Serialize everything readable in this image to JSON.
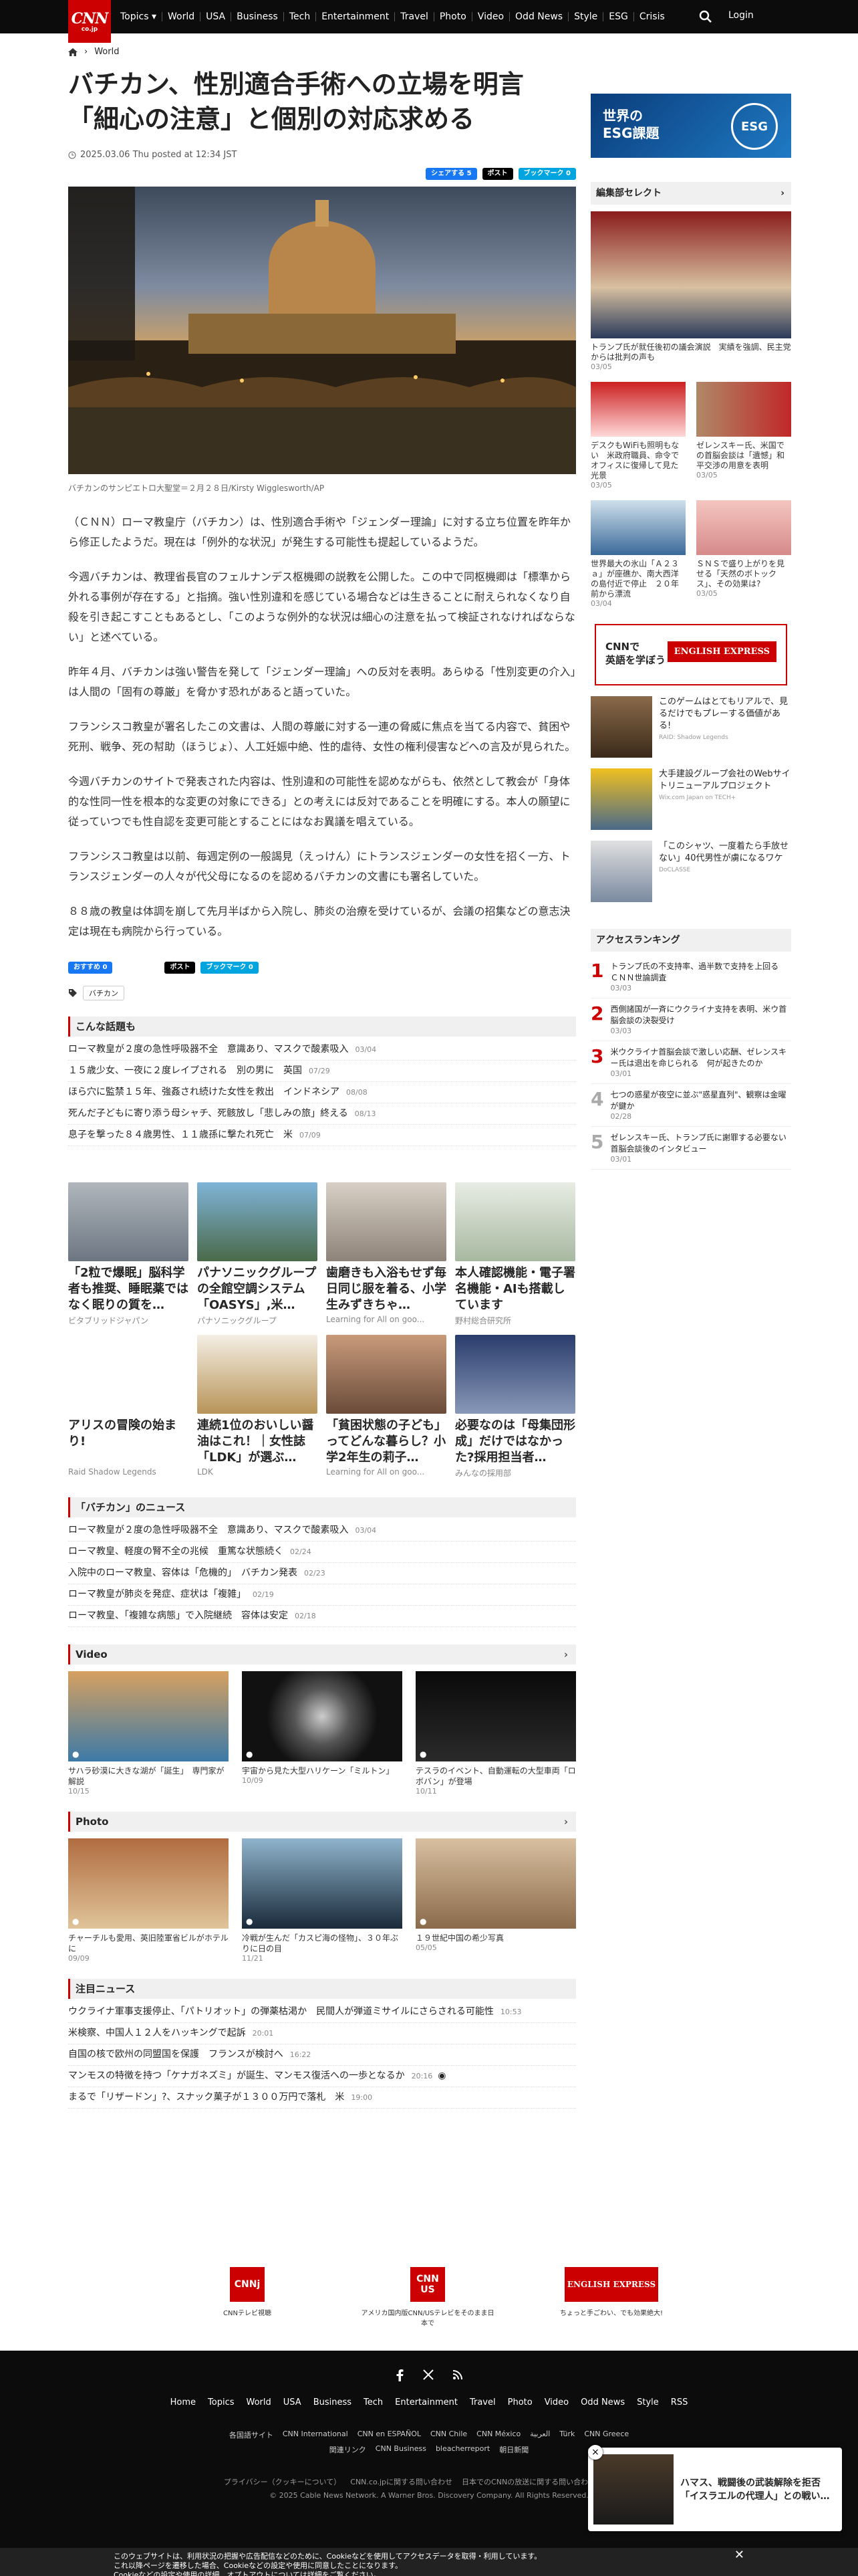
{
  "nav": {
    "items": [
      "Topics",
      "World",
      "USA",
      "Business",
      "Tech",
      "Entertainment",
      "Travel",
      "Photo",
      "Video",
      "Odd News",
      "Style",
      "ESG",
      "Crisis"
    ],
    "login": "Login",
    "logo_top": "CNN",
    "logo_bottom": "co.jp"
  },
  "breadcrumb": {
    "section": "World"
  },
  "article": {
    "title": "バチカン、性別適合手術への立場を明言　「細心の注意」と個別の対応求める",
    "date": "2025.03.06 Thu posted at 12:34 JST",
    "share": {
      "fb": "シェアする 5",
      "x": "ポスト",
      "hatena": "ブックマーク 0"
    },
    "caption": "バチカンのサンピエトロ大聖堂＝２月２８日/Kirsty Wigglesworth/AP",
    "paragraphs": [
      "（ＣＮＮ）ローマ教皇庁（バチカン）は、性別適合手術や「ジェンダー理論」に対する立ち位置を昨年から修正したようだ。現在は「例外的な状況」が発生する可能性も提起しているようだ。",
      "今週バチカンは、教理省長官のフェルナンデス枢機卿の説教を公開した。この中で同枢機卿は「標準から外れる事例が存在する」と指摘。強い性別違和を感じている場合などは生きることに耐えられなくなり自殺を引き起こすこともあるとし、「このような例外的な状況は細心の注意を払って検証されなければならない」と述べている。",
      "昨年４月、バチカンは強い警告を発して「ジェンダー理論」への反対を表明。あらゆる「性別変更の介入」は人間の「固有の尊厳」を脅かす恐れがあると語っていた。",
      "フランシスコ教皇が署名したこの文書は、人間の尊厳に対する一連の脅威に焦点を当てる内容で、貧困や死刑、戦争、死の幇助（ほうじょ）、人工妊娠中絶、性的虐待、女性の権利侵害などへの言及が見られた。",
      "今週バチカンのサイトで発表された内容は、性別違和の可能性を認めながらも、依然として教会が「身体的な性同一性を根本的な変更の対象にできる」との考えには反対であることを明確にする。本人の願望に従っていつでも性自認を変更可能とすることにはなお異議を唱えている。",
      "フランシスコ教皇は以前、毎週定例の一般謁見（えっけん）にトランスジェンダーの女性を招く一方、トランスジェンダーの人々が代父母になるのを認めるバチカンの文書にも署名していた。",
      "８８歳の教皇は体調を崩して先月半ばから入院し、肺炎の治療を受けているが、会議の招集などの意志決定は現在も病院から行っている。"
    ],
    "share2": {
      "fb": "おすすめ 0",
      "x": "ポスト",
      "hatena": "ブックマーク 0"
    },
    "tag": "バチカン"
  },
  "related": {
    "title": "こんな話題も",
    "items": [
      {
        "t": "ローマ教皇が２度の急性呼吸器不全　意識あり、マスクで酸素吸入",
        "d": "03/04"
      },
      {
        "t": "１５歳少女、一夜に２度レイプされる　別の男に　英国",
        "d": "07/29"
      },
      {
        "t": "ほら穴に監禁１５年、強姦され続けた女性を救出　インドネシア",
        "d": "08/08"
      },
      {
        "t": "死んだ子どもに寄り添う母シャチ、死骸放し「悲しみの旅」終える",
        "d": "08/13"
      },
      {
        "t": "息子を撃った８４歳男性、１１歳孫に撃たれ死亡　米",
        "d": "07/09"
      }
    ]
  },
  "ads": [
    {
      "t": "「2粒で爆眠」脳科学者も推奨、睡眠薬ではなく眠りの質を…",
      "s": "ビタブリッドジャパン"
    },
    {
      "t": "パナソニックグループの全館空調システム「OASYS」,米…",
      "s": "パナソニックグループ"
    },
    {
      "t": "歯磨きも入浴もせず毎日同じ服を着る、小学生みずきちゃ…",
      "s": "Learning for All on goo..."
    },
    {
      "t": "本人確認機能・電子署名機能・AIも搭載しています",
      "s": "野村総合研究所"
    },
    {
      "t": "アリスの冒険の始まり!",
      "s": "Raid Shadow Legends"
    },
    {
      "t": "連続1位のおいしい醤油はこれ！｜女性誌「LDK」が選ぶ…",
      "s": "LDK"
    },
    {
      "t": "「貧困状態の子ども」ってどんな暮らし？小学2年生の莉子…",
      "s": "Learning for All on goo..."
    },
    {
      "t": "必要なのは「母集団形成」だけではなかった?採用担当者…",
      "s": "みんなの採用部"
    }
  ],
  "vatican_news": {
    "title": "「バチカン」のニュース",
    "items": [
      {
        "t": "ローマ教皇が２度の急性呼吸器不全　意識あり、マスクで酸素吸入",
        "d": "03/04"
      },
      {
        "t": "ローマ教皇、軽度の腎不全の兆候　重篤な状態続く",
        "d": "02/24"
      },
      {
        "t": "入院中のローマ教皇、容体は「危機的」　バチカン発表",
        "d": "02/23"
      },
      {
        "t": "ローマ教皇が肺炎を発症、症状は「複雑」",
        "d": "02/19"
      },
      {
        "t": "ローマ教皇、「複雑な病態」で入院継続　容体は安定",
        "d": "02/18"
      }
    ]
  },
  "video": {
    "title": "Video",
    "items": [
      {
        "t": "サハラ砂漠に大きな湖が「誕生」　専門家が解説",
        "d": "10/15"
      },
      {
        "t": "宇宙から見た大型ハリケーン「ミルトン」",
        "d": "10/09"
      },
      {
        "t": "テスラのイベント、自動運転の大型車両「ロボバン」が登場",
        "d": "10/11"
      }
    ]
  },
  "photo": {
    "title": "Photo",
    "items": [
      {
        "t": "チャーチルも愛用、英旧陸軍省ビルがホテルに",
        "d": "09/09"
      },
      {
        "t": "冷戦が生んだ「カスピ海の怪物」、３０年ぶりに日の目",
        "d": "11/21"
      },
      {
        "t": "１９世紀中国の希少写真",
        "d": "05/05"
      }
    ]
  },
  "featured": {
    "title": "注目ニュース",
    "items": [
      {
        "t": "ウクライナ軍事支援停止、「パトリオット」の弾薬枯渇か　民間人が弾道ミサイルにさらされる可能性",
        "d": "10:53"
      },
      {
        "t": "米検察、中国人１２人をハッキングで起訴",
        "d": "20:01"
      },
      {
        "t": "自国の核で欧州の同盟国を保護　フランスが検討へ",
        "d": "16:22"
      },
      {
        "t": "マンモスの特徴を持つ「ケナガネズミ」が誕生、マンモス復活への一歩となるか",
        "d": "20:16"
      },
      {
        "t": "まるで「リザードン」?、スナック菓子が１３００万円で落札　米",
        "d": "19:00"
      }
    ]
  },
  "sidebar": {
    "esg_title": "世界の\nESG課題",
    "esg_label": "ESG",
    "picks_title": "編集部セレクト",
    "big": {
      "t": "トランプ氏が就任後初の議会演説　実績を強調、民主党からは批判の声も",
      "d": "03/05"
    },
    "pairs": [
      {
        "t": "デスクもWiFiも照明もない　米政府職員、命令でオフィスに復帰して見た光景",
        "d": "03/05"
      },
      {
        "t": "ゼレンスキー氏、米国での首脳会談は「遺憾」和平交渉の用意を表明",
        "d": "03/05"
      },
      {
        "t": "世界最大の氷山「Ａ２３ａ」が座礁か、南大西洋の島付近で停止　２０年前から漂流",
        "d": "03/04"
      },
      {
        "t": "ＳＮＳで盛り上がりを見せる「天然のボトックス」、その効果は?",
        "d": "03/05"
      }
    ],
    "english_label": "CNNで\n英語を学ぼう",
    "english_brand": "ENGLISH EXPRESS",
    "sponsored": [
      {
        "t": "このゲームはとてもリアルで、見るだけでもプレーする価値がある!",
        "s": "RAID: Shadow Legends"
      },
      {
        "t": "大手建設グループ会社のWebサイトリニューアルプロジェクト",
        "s": "Wix.com Japan on TECH+"
      },
      {
        "t": "「このシャツ、一度着たら手放せない」40代男性が虜になるワケ",
        "s": "DoCLASSE"
      }
    ],
    "ranking_title": "アクセスランキング",
    "ranking": [
      {
        "t": "トランプ氏の不支持率、過半数で支持を上回る　ＣＮＮ世論調査",
        "d": "03/03"
      },
      {
        "t": "西側諸国が一斉にウクライナ支持を表明、米ウ首脳会談の決裂受け",
        "d": "03/03"
      },
      {
        "t": "米ウクライナ首脳会談で激しい応酬、ゼレンスキー氏は退出を命じられる　何が起きたのか",
        "d": "03/01"
      },
      {
        "t": "七つの惑星が夜空に並ぶ\"惑星直列\"、観察は金曜が鍵か",
        "d": "02/28"
      },
      {
        "t": "ゼレンスキー氏、トランプ氏に謝罪する必要ない　首脳会談後のインタビュー",
        "d": "03/01"
      }
    ]
  },
  "footer_logos": [
    {
      "b": "CNNj",
      "s": "CNNテレビ視聴"
    },
    {
      "b": "CNN US",
      "s": "アメリカ国内版CNN/USテレビをそのまま日本で"
    },
    {
      "b": "ENGLISH EXPRESS",
      "s": "ちょっと手ごわい、でも効果絶大!"
    }
  ],
  "footer": {
    "nav": [
      "Home",
      "Topics",
      "World",
      "USA",
      "Business",
      "Tech",
      "Entertainment",
      "Travel",
      "Photo",
      "Video",
      "Odd News",
      "Style",
      "RSS"
    ],
    "sub1": [
      "各国語サイト",
      "CNN International",
      "CNN en ESPAÑOL",
      "CNN Chile",
      "CNN México",
      "العربية",
      "Türk",
      "CNN Greece"
    ],
    "sub2": [
      "関連リンク",
      "CNN Business",
      "bleacherreport",
      "朝日新聞"
    ],
    "sub3": [
      "プライバシー（クッキーについて）",
      "CNN.co.jpに関する問い合わせ",
      "日本でのCNNの放送に関する問い合わせ",
      "広告掲載"
    ],
    "copyright": "© 2025 Cable News Network. A Warner Bros. Discovery Company. All Rights Reserved."
  },
  "popup": {
    "t": "ハマス、戦闘後の武装解除を拒否「イスラエルの代理人」との戦い…"
  },
  "cookie": {
    "l1": "このウェブサイトは、利用状況の把握や広告配信などのために、Cookieなどを使用してアクセスデータを取得・利用しています。",
    "l2": "これ以降ページを遷移した場合、Cookieなどの設定や使用に同意したことになります。",
    "l3": "Cookieなどの設定や使用の詳細、オプトアウトについては詳細をご覧ください。"
  }
}
